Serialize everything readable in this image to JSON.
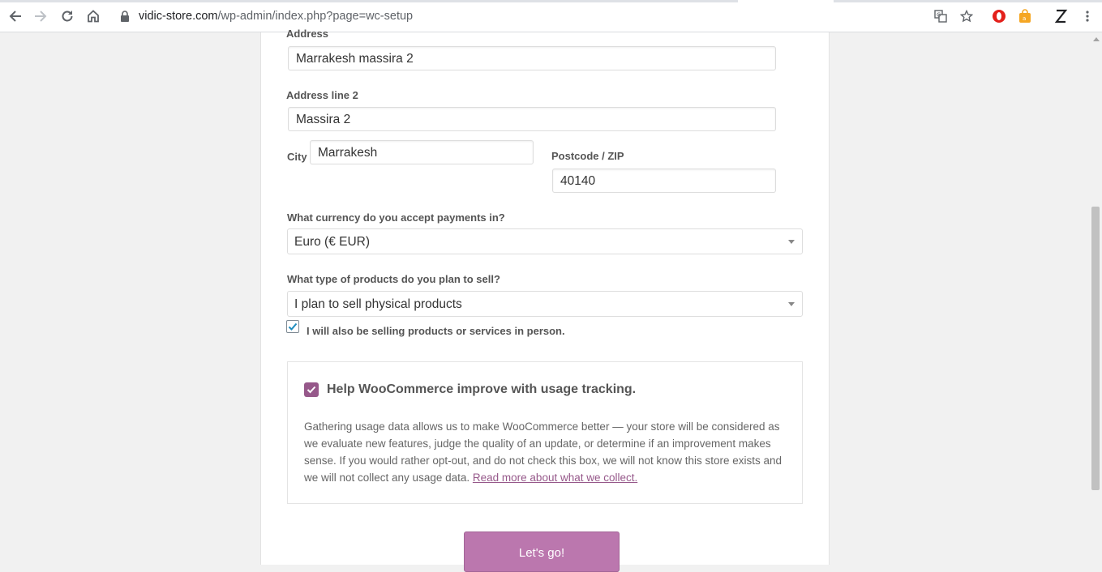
{
  "browser": {
    "url_host": "vidic-store.com",
    "url_path": "/wp-admin/index.php?page=wc-setup"
  },
  "form": {
    "address_label": "Address",
    "address_value": "Marrakesh massira 2",
    "address2_label": "Address line 2",
    "address2_value": "Massira 2",
    "city_label": "City",
    "city_value": "Marrakesh",
    "postcode_label": "Postcode / ZIP",
    "postcode_value": "40140",
    "currency_label": "What currency do you accept payments in?",
    "currency_value": "Euro (€ EUR)",
    "product_type_label": "What type of products do you plan to sell?",
    "product_type_value": "I plan to sell physical products",
    "in_person_label": "I will also be selling products or services in person.",
    "in_person_checked": true
  },
  "tracking": {
    "title": "Help WooCommerce improve with usage tracking.",
    "checked": true,
    "text": "Gathering usage data allows us to make WooCommerce better — your store will be considered as we evaluate new features, judge the quality of an update, or determine if an improvement makes sense. If you would rather opt-out, and do not check this box, we will not know this store exists and we will not collect any usage data.",
    "link_text": "Read more about what we collect."
  },
  "actions": {
    "submit_label": "Let's go!"
  },
  "colors": {
    "accent": "#96588a",
    "button": "#bb77ae",
    "checkbox_blue": "#1e8cbe"
  }
}
